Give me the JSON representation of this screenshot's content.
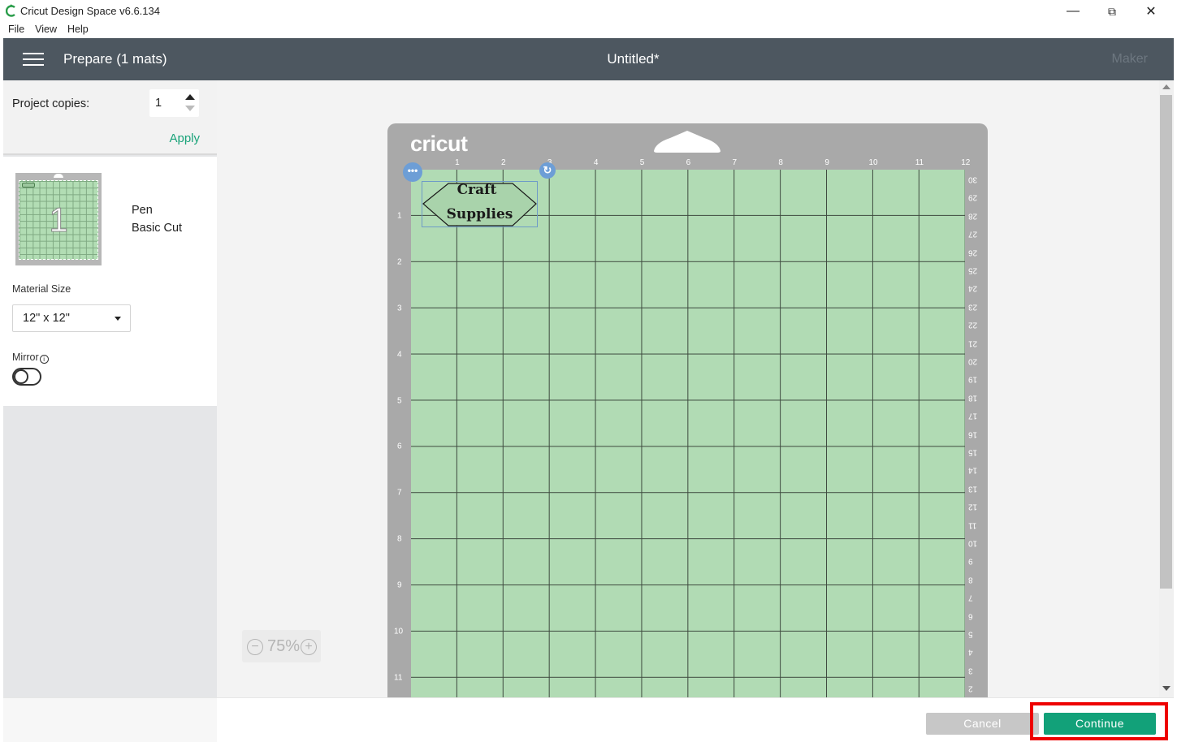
{
  "window": {
    "app_title": "Cricut Design Space  v6.6.134",
    "controls": {
      "minimize": "—",
      "restore": "⧉",
      "close": "✕"
    }
  },
  "menubar": [
    "File",
    "View",
    "Help"
  ],
  "header": {
    "title": "Prepare (1 mats)",
    "document_title": "Untitled*",
    "machine": "Maker"
  },
  "left_panel": {
    "copies_label": "Project copies:",
    "copies_value": "1",
    "apply_label": "Apply",
    "mat": {
      "number": "1",
      "line1": "Pen",
      "line2": "Basic Cut"
    },
    "material_size_label": "Material Size",
    "material_size_value": "12\" x 12\"",
    "mirror_label": "Mirror",
    "mirror_on": false
  },
  "mat_preview": {
    "brand": "cricut",
    "ruler_top": [
      "1",
      "2",
      "3",
      "4",
      "5",
      "6",
      "7",
      "8",
      "9",
      "10",
      "11",
      "12"
    ],
    "ruler_left": [
      "1",
      "2",
      "3",
      "4",
      "5",
      "6",
      "7",
      "8",
      "9",
      "10",
      "11"
    ],
    "ruler_right": [
      "30",
      "29",
      "28",
      "27",
      "26",
      "25",
      "24",
      "23",
      "22",
      "21",
      "20",
      "19",
      "18",
      "17",
      "16",
      "15",
      "14",
      "13",
      "12",
      "11",
      "10",
      "9",
      "8",
      "7",
      "6",
      "5",
      "4",
      "3",
      "2"
    ],
    "design_line1": "Craft",
    "design_line2": "Supplies",
    "colors": {
      "mat_green": "#b1dbb4",
      "mat_frame": "#a9a9a9",
      "handle_blue": "#6d9ed6"
    }
  },
  "zoom": {
    "minus": "−",
    "value": "75%",
    "plus": "+"
  },
  "footer": {
    "cancel_label": "Cancel",
    "continue_label": "Continue",
    "accent": "#12a179"
  }
}
